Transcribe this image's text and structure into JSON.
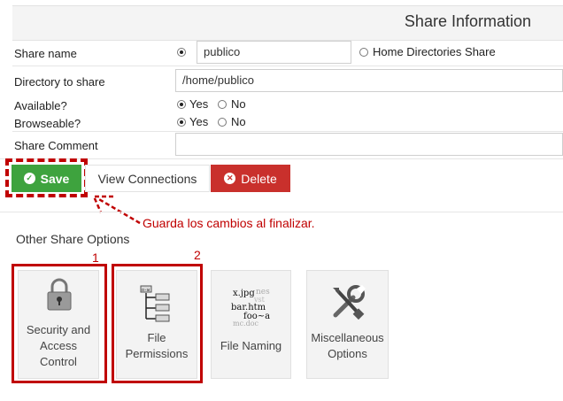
{
  "header": {
    "title": "Share Information"
  },
  "form": {
    "share_name": {
      "label": "Share name",
      "value": "publico",
      "alt_option": "Home Directories Share"
    },
    "directory": {
      "label": "Directory to share",
      "value": "/home/publico"
    },
    "available": {
      "label": "Available?",
      "yes": "Yes",
      "no": "No",
      "selected": "Yes"
    },
    "browseable": {
      "label": "Browseable?",
      "yes": "Yes",
      "no": "No",
      "selected": "Yes"
    },
    "comment": {
      "label": "Share Comment",
      "value": ""
    }
  },
  "actions": {
    "save_label": "Save",
    "view_connections_label": "View Connections",
    "delete_label": "Delete"
  },
  "annotation": {
    "text": "Guarda los cambios al finalizar."
  },
  "other_options": {
    "title": "Other Share Options",
    "tiles": [
      {
        "label_lines": [
          "Security and",
          "Access",
          "Control"
        ],
        "icon": "padlock-icon",
        "marker": "1"
      },
      {
        "label_lines": [
          "File",
          "Permissions"
        ],
        "icon": "file-tree-icon",
        "marker": "2"
      },
      {
        "label_lines": [
          "File Naming"
        ],
        "icon": "file-names-icon"
      },
      {
        "label_lines": [
          "Miscellaneous",
          "Options"
        ],
        "icon": "tools-icon"
      }
    ]
  },
  "colors": {
    "save": "#3ea33e",
    "delete": "#c9302c",
    "highlight": "#c00000"
  }
}
